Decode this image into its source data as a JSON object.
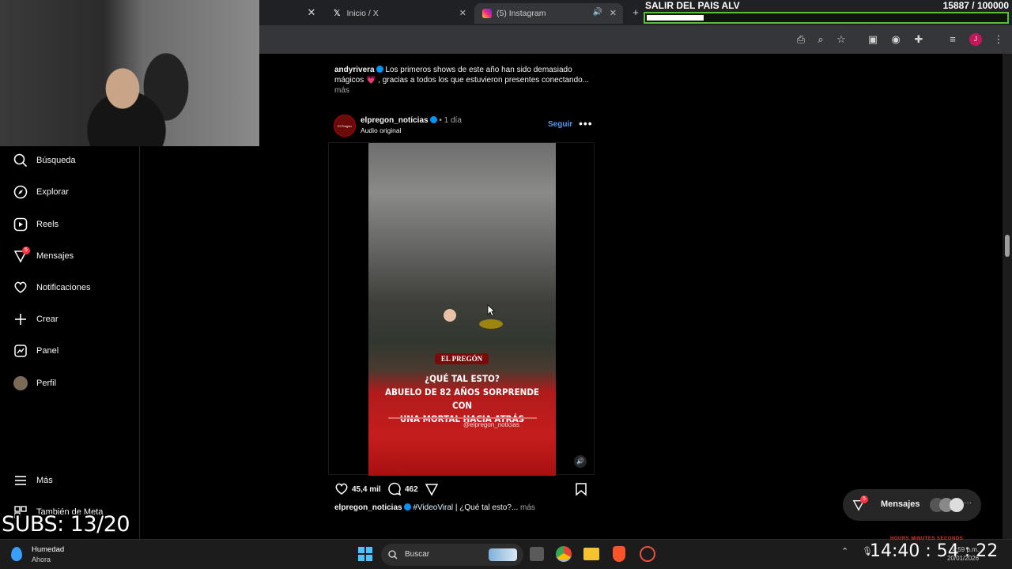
{
  "browser": {
    "tabs": [
      {
        "label": "Inicio / X"
      },
      {
        "label": "(5) Instagram"
      }
    ]
  },
  "goal": {
    "title": "SALIR DEL PAIS ALV",
    "count": "15887  / 100000",
    "progress": 0.159
  },
  "sidebar": {
    "items": [
      {
        "label": "Búsqueda"
      },
      {
        "label": "Explorar"
      },
      {
        "label": "Reels"
      },
      {
        "label": "Mensajes",
        "badge": "5"
      },
      {
        "label": "Notificaciones"
      },
      {
        "label": "Crear"
      },
      {
        "label": "Panel"
      },
      {
        "label": "Perfil"
      },
      {
        "label": "Más"
      },
      {
        "label": "También de Meta"
      }
    ]
  },
  "overlay": {
    "subs": "SUBS: 13/20"
  },
  "feed": {
    "previous": {
      "user": "andyrivera",
      "caption": "Los primeros shows de este año han sido demasiado mágicos 💗 , gracias a todos los que estuvieron presentes conectando...",
      "more": "más"
    },
    "post": {
      "user": "elpregon_noticias",
      "time": "• 1 día",
      "audio": "Audio original",
      "follow": "Seguir",
      "avatar_text": "El Pregón",
      "video": {
        "brand": "EL PREGÓN",
        "headline_1": "¿QUÉ TAL ESTO?",
        "headline_2": "ABUELO DE 82 AÑOS SORPRENDE CON",
        "headline_3": "UNA MORTAL HACIA ATRÁS",
        "handle": "@elpregon_noticias"
      },
      "likes": "45,4 mil",
      "comments": "462",
      "caption_user": "elpregon_noticias",
      "caption_tag": "#VideoViral",
      "caption_text": " | ¿Qué tal esto?...",
      "caption_more": " más"
    }
  },
  "messages_pill": {
    "label": "Mensajes",
    "badge": "5"
  },
  "taskbar": {
    "weather_title": "Humedad",
    "weather_sub": "Ahora",
    "search": "Buscar",
    "timer": "14:40 : 54 : 22",
    "timer_labels": "HOURS   MINUTES   SECONDS",
    "clock_time": "4:59 p.m.",
    "clock_date": "20/01/2026"
  },
  "colors": {
    "accent": "#0095f6",
    "goal_bar": "#5bbd3a",
    "badge": "#ff3040"
  }
}
